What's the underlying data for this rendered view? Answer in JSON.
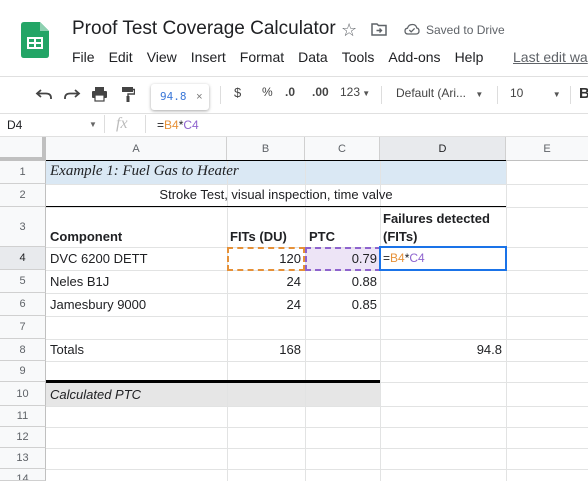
{
  "header": {
    "doc_title": "Proof Test Coverage Calculator",
    "saved_status": "Saved to Drive",
    "last_edit": "Last edit wa"
  },
  "menu": [
    "File",
    "Edit",
    "View",
    "Insert",
    "Format",
    "Data",
    "Tools",
    "Add-ons",
    "Help"
  ],
  "toolbar": {
    "tooltip_value": "94.8",
    "tooltip_close": "×",
    "currency": "$",
    "percent": "%",
    "dec_decrease": ".0",
    "dec_increase": ".00",
    "more_formats": "123",
    "font": "Default (Ari...",
    "font_size": "10",
    "bold": "B"
  },
  "formula_bar": {
    "cell_ref": "D4",
    "fx": "fx",
    "formula_eq": "=",
    "formula_ref1": "B4",
    "formula_op": "*",
    "formula_ref2": "C4"
  },
  "columns": [
    "A",
    "B",
    "C",
    "D",
    "E"
  ],
  "rows": [
    "1",
    "2",
    "3",
    "4",
    "5",
    "6",
    "7",
    "8",
    "9",
    "10",
    "11",
    "12",
    "13",
    "14"
  ],
  "cells": {
    "A1": "Example 1: Fuel Gas to Heater",
    "A2": "Stroke Test, visual inspection, time valve",
    "A3": "Component",
    "B3": "FITs (DU)",
    "C3": "PTC",
    "D3a": "Failures detected",
    "D3b": "(FITs)",
    "A4": "DVC 6200 DETT",
    "B4": "120",
    "C4": "0.79",
    "D4_eq": "=",
    "D4_ref1": "B4",
    "D4_op": "*",
    "D4_ref2": "C4",
    "A5": "Neles B1J",
    "B5": "24",
    "C5": "0.88",
    "A6": "Jamesbury 9000",
    "B6": "24",
    "C6": "0.85",
    "A8": "Totals",
    "B8": "168",
    "D8": "94.8",
    "A10": "Calculated PTC"
  },
  "colors": {
    "accent": "#1a73e8",
    "ref_orange": "#e69138",
    "ref_purple": "#8e63ce",
    "title_bg": "#dae8f4",
    "calc_bg": "#e6e6e6"
  }
}
